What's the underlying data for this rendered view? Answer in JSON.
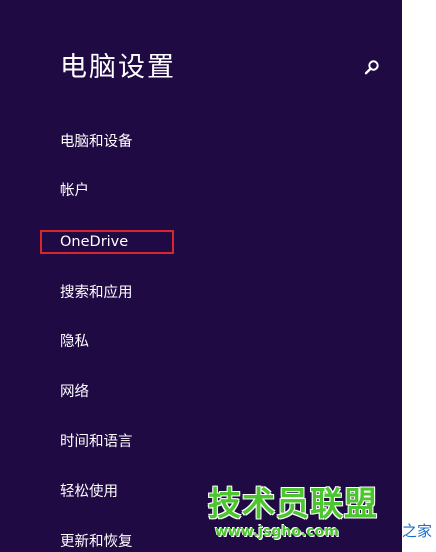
{
  "header": {
    "title": "电脑设置",
    "search_icon": "search-icon"
  },
  "menu": {
    "items": [
      {
        "label": "电脑和设备"
      },
      {
        "label": "帐户"
      },
      {
        "label": "OneDrive",
        "highlighted": true
      },
      {
        "label": "搜索和应用"
      },
      {
        "label": "隐私"
      },
      {
        "label": "网络"
      },
      {
        "label": "时间和语言"
      },
      {
        "label": "轻松使用"
      },
      {
        "label": "更新和恢复"
      }
    ]
  },
  "watermark": {
    "logo_text": "技术员联盟",
    "url": "www.jsgho.com",
    "tail": "之家"
  },
  "colors": {
    "background": "#200a44",
    "text": "#ffffff",
    "highlight_border": "#d8262e",
    "watermark_green": "#4cc62e"
  }
}
